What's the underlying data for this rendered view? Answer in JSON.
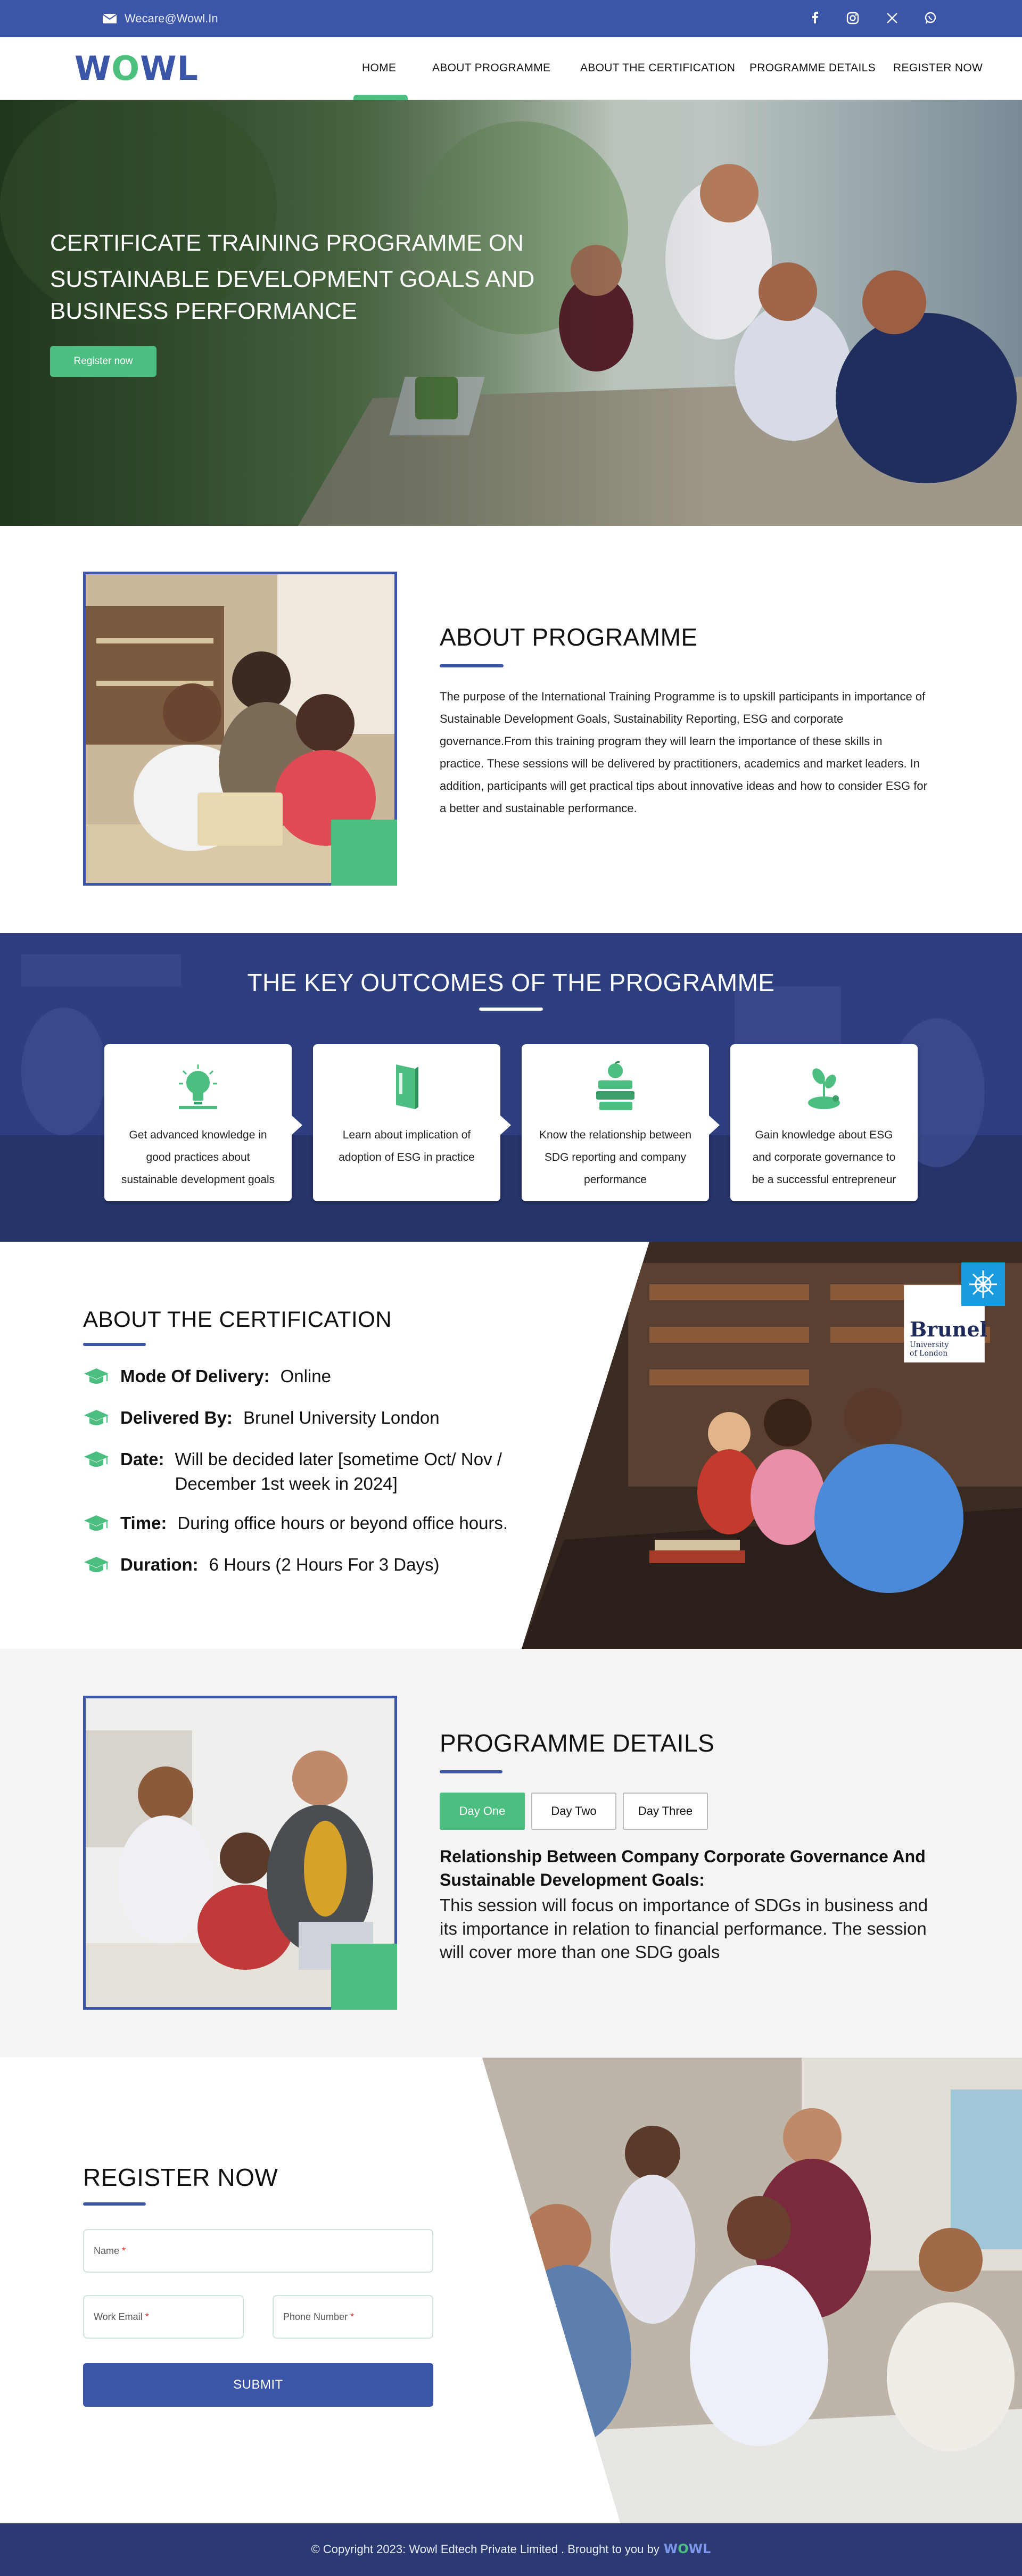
{
  "topbar": {
    "email": "Wecare@Wowl.In",
    "social_icons": [
      "facebook-icon",
      "instagram-icon",
      "x-icon",
      "whatsapp-icon"
    ]
  },
  "brand": {
    "logo_text_prefix": "W",
    "logo_text_o": "O",
    "logo_text_suffix": "WL",
    "primary_color": "#3b55a8",
    "accent_color": "#4cbf80"
  },
  "nav": {
    "items": [
      {
        "label": "HOME",
        "active": true
      },
      {
        "label": "ABOUT PROGRAMME",
        "active": false
      },
      {
        "label": "ABOUT THE CERTIFICATION",
        "active": false
      },
      {
        "label": "PROGRAMME DETAILS",
        "active": false
      },
      {
        "label": "REGISTER NOW",
        "active": false
      }
    ]
  },
  "hero": {
    "line1": "CERTIFICATE TRAINING PROGRAMME ON",
    "line2": "SUSTAINABLE DEVELOPMENT GOALS AND",
    "line3": "BUSINESS PERFORMANCE",
    "button": "Register now"
  },
  "about": {
    "title": "ABOUT PROGRAMME",
    "text": "The purpose of the International Training Programme is to upskill participants in importance of Sustainable Development Goals, Sustainability Reporting, ESG and corporate governance.From this training program they will learn the importance of these skills in practice. These sessions will be delivered by practitioners, academics and market leaders. In addition, participants will get practical tips about innovative ideas and how to consider ESG for a better and sustainable performance."
  },
  "outcomes": {
    "title": "THE KEY OUTCOMES OF THE PROGRAMME",
    "cards": [
      {
        "icon": "lightbulb-icon",
        "text": "Get advanced knowledge in good practices about sustainable development goals"
      },
      {
        "icon": "book-icon",
        "text": "Learn about implication of adoption of ESG in practice"
      },
      {
        "icon": "books-apple-icon",
        "text": "Know the relationship between SDG reporting and company performance"
      },
      {
        "icon": "plant-icon",
        "text": "Gain knowledge about ESG and corporate governance to be a successful entrepreneur"
      }
    ]
  },
  "certification": {
    "title": "ABOUT THE CERTIFICATION",
    "rows": [
      {
        "label": "Mode Of Delivery:",
        "value": "Online"
      },
      {
        "label": "Delivered By:",
        "value": "Brunel University London"
      },
      {
        "label": "Date:",
        "value": "Will be decided later [sometime Oct/ Nov / December 1st week in 2024]"
      },
      {
        "label": "Time:",
        "value": "During office hours or beyond office hours."
      },
      {
        "label": "Duration:",
        "value": "6 Hours (2 Hours For 3 Days)"
      }
    ],
    "partner_name": "Brunel",
    "partner_sub1": "University",
    "partner_sub2": "of London"
  },
  "details": {
    "title": "PROGRAMME DETAILS",
    "tabs": [
      {
        "label": "Day One",
        "active": true
      },
      {
        "label": "Day Two",
        "active": false
      },
      {
        "label": "Day Three",
        "active": false
      }
    ],
    "heading": "Relationship Between Company Corporate Governance And Sustainable Development Goals:",
    "body": "This session will focus on importance of SDGs in business and its importance in relation to financial performance. The session will cover more than one SDG goals"
  },
  "register": {
    "title": "REGISTER NOW",
    "name_placeholder": "Name",
    "email_placeholder": "Work Email",
    "phone_placeholder": "Phone  Number",
    "required_marker": "*",
    "submit": "SUBMIT"
  },
  "footer": {
    "copyright": "© Copyright 2023: Wowl Edtech Private Limited . Brought to you by"
  }
}
